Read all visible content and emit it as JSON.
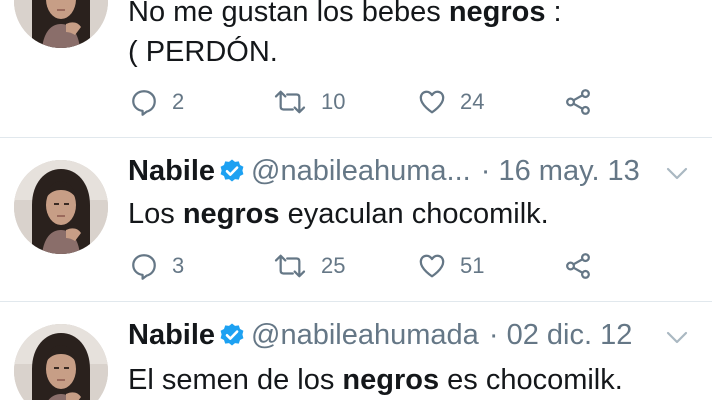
{
  "tweets": [
    {
      "name": "",
      "handle": "",
      "time": "",
      "text_before": "No me gustan los bebes ",
      "text_bold": "negros",
      "text_after": " :",
      "text_line2": "( PERDÓN.",
      "replies": "2",
      "retweets": "10",
      "likes": "24"
    },
    {
      "name": "Nabile",
      "handle": "@nabileahuma...",
      "time": "· 16 may. 13",
      "text_before": "Los ",
      "text_bold": "negros",
      "text_after": " eyaculan chocomilk.",
      "replies": "3",
      "retweets": "25",
      "likes": "51"
    },
    {
      "name": "Nabile",
      "handle": "@nabileahumada",
      "time": "· 02 dic. 12",
      "text_before": "El semen de los ",
      "text_bold": "negros",
      "text_after": " es chocomilk."
    }
  ],
  "colors": {
    "text": "#14171a",
    "muted": "#657786",
    "verified": "#1da1f2",
    "divider": "#e1e8ed"
  },
  "icons": [
    "reply-icon",
    "retweet-icon",
    "like-icon",
    "share-icon",
    "verified-badge-icon",
    "chevron-down-icon"
  ]
}
